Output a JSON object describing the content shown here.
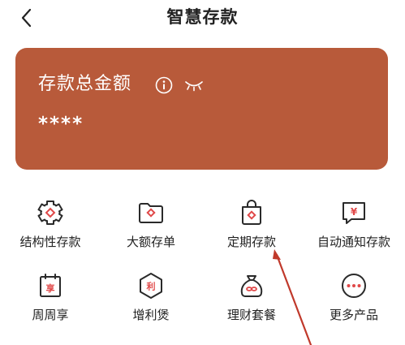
{
  "header": {
    "title": "智慧存款"
  },
  "card": {
    "label": "存款总金额",
    "amount": "****",
    "color": "#b85a3a"
  },
  "products": [
    {
      "label": "结构性存款",
      "icon": "puzzle-gear-icon"
    },
    {
      "label": "大额存单",
      "icon": "folder-icon"
    },
    {
      "label": "定期存款",
      "icon": "bag-icon"
    },
    {
      "label": "自动通知存款",
      "icon": "message-yuan-icon"
    },
    {
      "label": "周周享",
      "icon": "calendar-icon"
    },
    {
      "label": "增利煲",
      "icon": "hexagon-badge-icon"
    },
    {
      "label": "理财套餐",
      "icon": "money-bag-icon"
    },
    {
      "label": "更多产品",
      "icon": "more-dots-icon"
    }
  ],
  "colors": {
    "accent": "#e04848",
    "icon_stroke": "#2a2a2a",
    "arrow": "#c0392b"
  }
}
